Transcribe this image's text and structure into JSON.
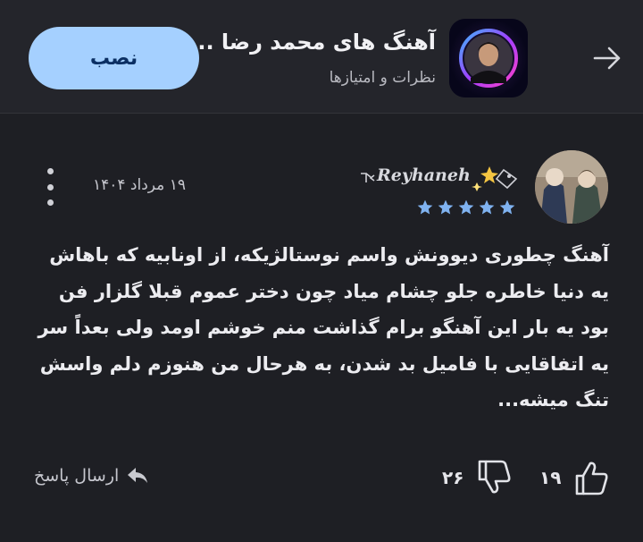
{
  "header": {
    "app_title": "آهنگ های محمد رضا ...",
    "subtitle": "نظرات و امتیازها",
    "install_label": "نصب"
  },
  "review": {
    "username": "Reyhaneh",
    "rating": 5,
    "rating_max": 5,
    "date": "۱۹ مرداد ۱۴۰۴",
    "text": "آهنگ چطوری دیوونش واسم نوستالژیکه، از اونابیه که باهاش یه دنیا خاطره جلو چشام میاد چون دختر عموم قبلا گلزار فن بود یه بار این آهنگو برام گذاشت منم خوشم اومد ولی بعداً سر یه اتفاقایی با فامیل بد شدن، به هرحال من هنوزم دلم واسش تنگ میشه...",
    "likes": "۱۹",
    "dislikes": "۲۶",
    "reply_label": "ارسال پاسخ"
  },
  "colors": {
    "background": "#1e1f24",
    "header_bg": "#24252b",
    "install_button": "#a5d0ff",
    "install_text": "#0b2f63",
    "star": "#7fb2f0"
  },
  "icons": [
    "back-arrow-icon",
    "more-vert-icon",
    "thumb-up-icon",
    "thumb-down-icon",
    "reply-arrow-icon",
    "star-icon"
  ]
}
